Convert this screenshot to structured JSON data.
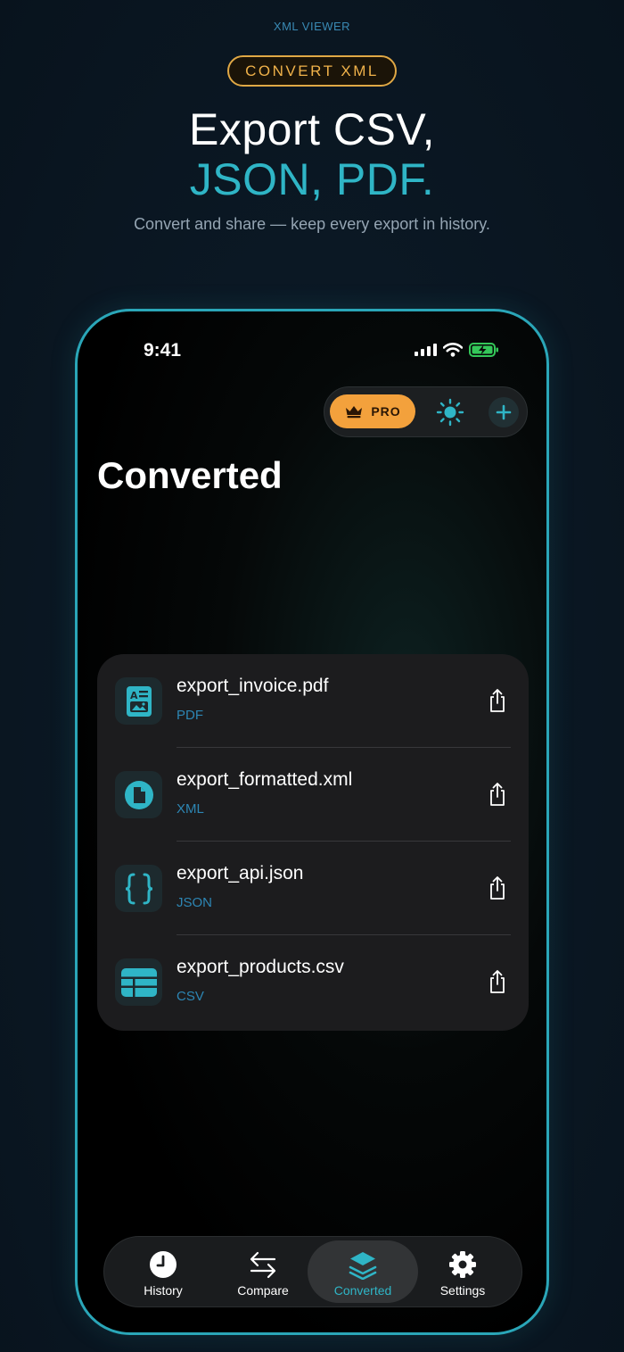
{
  "hero": {
    "eyebrow": "XML VIEWER",
    "badge": "CONVERT XML",
    "headline_1": "Export CSV,",
    "headline_2": "JSON, PDF.",
    "subtitle": "Convert and share — keep every export in history."
  },
  "status_bar": {
    "time": "9:41"
  },
  "toolbar": {
    "pro_label": "PRO"
  },
  "page_title": "Converted",
  "files": [
    {
      "name": "export_invoice.pdf",
      "type": "PDF",
      "icon": "pdf-document-icon"
    },
    {
      "name": "export_formatted.xml",
      "type": "XML",
      "icon": "xml-document-icon"
    },
    {
      "name": "export_api.json",
      "type": "JSON",
      "icon": "json-braces-icon"
    },
    {
      "name": "export_products.csv",
      "type": "CSV",
      "icon": "csv-table-icon"
    }
  ],
  "tabs": [
    {
      "label": "History",
      "icon": "clock-icon"
    },
    {
      "label": "Compare",
      "icon": "arrows-compare-icon"
    },
    {
      "label": "Converted",
      "icon": "layers-icon",
      "active": true
    },
    {
      "label": "Settings",
      "icon": "gear-icon"
    }
  ],
  "colors": {
    "accent": "#2fb5c6",
    "pro": "#f3a13c",
    "type_label": "#2d86b4",
    "badge": "#e0a845"
  }
}
